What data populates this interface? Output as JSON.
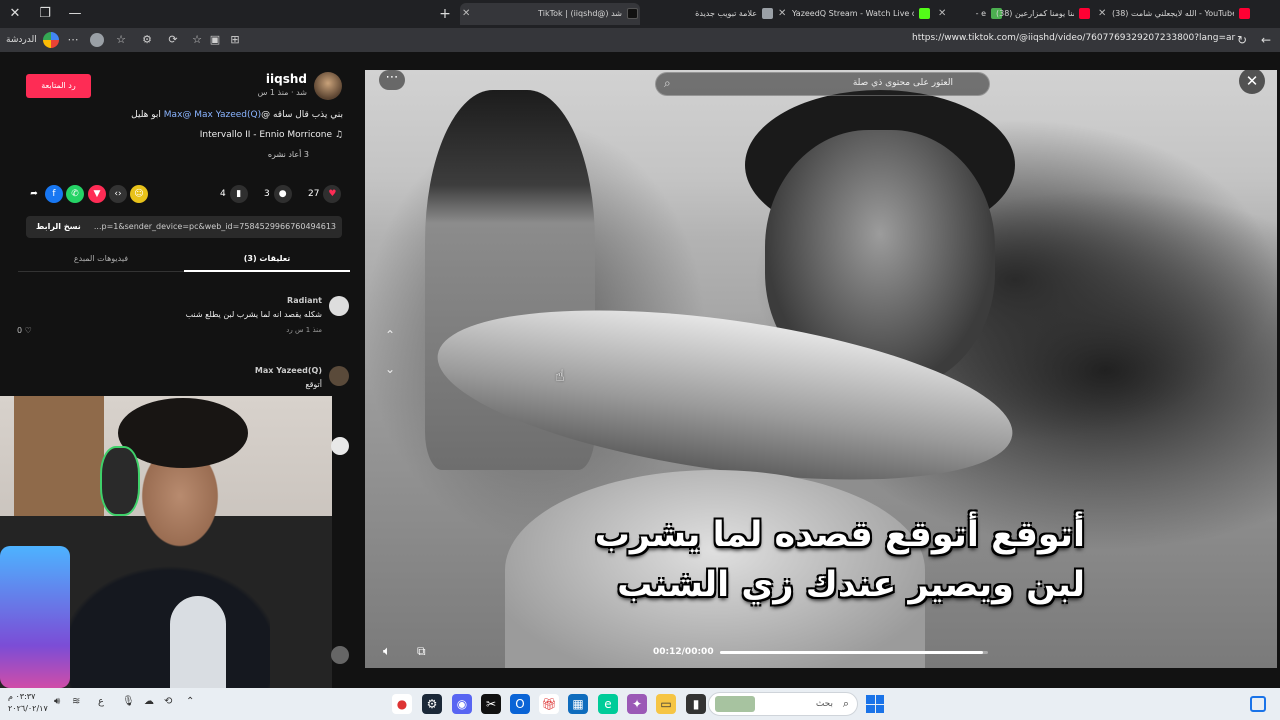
{
  "browser": {
    "tabs": [
      {
        "title": "(38) الله لايجعلني شامت - YouTube",
        "icon": "youtube-icon",
        "color": "#ff0033"
      },
      {
        "title": "(38) عشنا يومنا كمزارعين",
        "icon": "youtube-icon",
        "color": "#ff0033"
      },
      {
        "title": "- e",
        "icon": "game-icon",
        "color": "#4caf50"
      },
      {
        "title": "YazeedQ Stream - Watch Live on",
        "icon": "kick-icon",
        "color": "#53fc18"
      },
      {
        "title": "علامة تبويب جديدة",
        "icon": "newtab-icon",
        "color": "#9aa0a6"
      },
      {
        "title": "TikTok | (iiqshd@) شد",
        "icon": "tiktok-icon",
        "color": "#000000",
        "active": true
      }
    ],
    "url": "https://www.tiktok.com/@iiqshd/video/7607769329207233800?lang=ar",
    "profile_label": "الدردشة"
  },
  "post": {
    "follow_label": "رد المتابعة",
    "username": "iiqshd",
    "subline": "شد · منذ 1 س",
    "description_prefix": "بني يذب قال ساقه @",
    "mention": "Max@ Max Yazeed(Q)",
    "description_suffix": " ابو هليل",
    "music": "Intervallo II - Ennio Morricone",
    "reposts": "3 أعاد نشره",
    "likes": "27",
    "comments": "3",
    "saves": "4",
    "copy_link_label": "نسخ الرابط",
    "link_text": "...p=1&sender_device=pc&web_id=7584529966760494613",
    "tab_comments": "(3) تعليقات",
    "tab_creator_videos": "فيديوهات المبدع"
  },
  "comments": [
    {
      "name": "Radiant",
      "text": "شكله يقصد انه لما يشرب لبن يطلع شنب",
      "meta": "منذ 1 س   رد",
      "likes": "0"
    },
    {
      "name": "Max Yazeed(Q)",
      "text": "أتوقع",
      "meta": "",
      "likes": ""
    }
  ],
  "video": {
    "search_placeholder": "العثور على محتوى ذي صلة",
    "caption_line1": "أتوقع أتوقع قصده لما يشرب",
    "caption_line2": "لبن ويصير عندك زي الشنب",
    "time": "00:12/00:00",
    "progress": 0.98
  },
  "taskbar": {
    "search_placeholder": "بحث",
    "clock_time": "٠٣:٣٧ م",
    "clock_date": "٢٠٢٦/٠٢/١٧",
    "lang": "ع"
  }
}
